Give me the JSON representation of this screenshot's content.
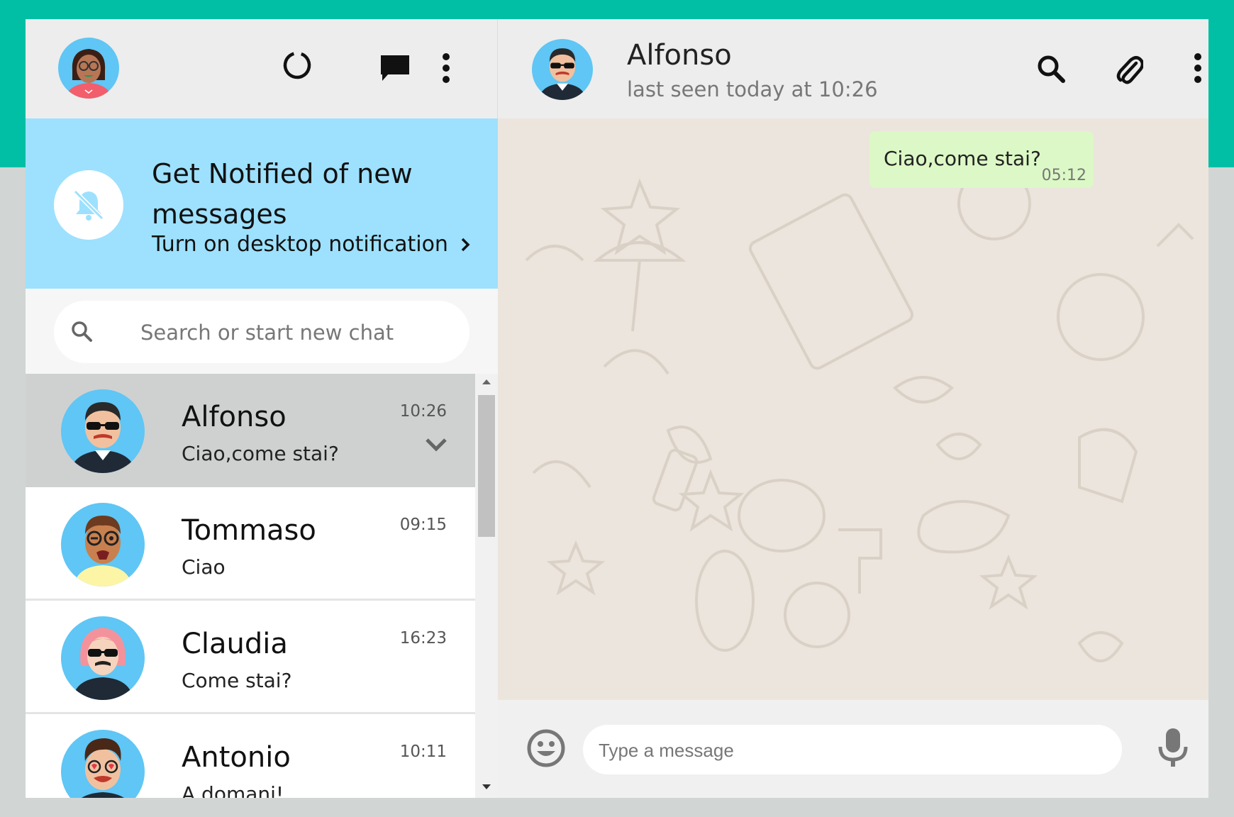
{
  "colors": {
    "brand": "#00bfa5",
    "header_bg": "#ededed",
    "notification_bg": "#9de1fe",
    "active_chat_bg": "#cfd1d1",
    "outgoing_bubble": "#dcf8c6",
    "chat_background": "#ece5dd"
  },
  "sidebar": {
    "header": {
      "icons": [
        "user-avatar",
        "status-icon",
        "new-chat-icon",
        "menu-icon"
      ]
    },
    "notification": {
      "title": "Get Notified of new messages",
      "subtitle": "Turn on desktop notification",
      "icon": "bell-off-icon"
    },
    "search": {
      "placeholder": "Search or start new chat",
      "value": ""
    },
    "chats": [
      {
        "name": "Alfonso",
        "last_message": "Ciao,come stai?",
        "time": "10:26",
        "active": true
      },
      {
        "name": "Tommaso",
        "last_message": "Ciao",
        "time": "09:15",
        "active": false
      },
      {
        "name": "Claudia",
        "last_message": "Come stai?",
        "time": "16:23",
        "active": false
      },
      {
        "name": "Antonio",
        "last_message": "A domani!",
        "time": "10:11",
        "active": false
      }
    ]
  },
  "conversation": {
    "contact_name": "Alfonso",
    "contact_status": "last seen today at 10:26",
    "header_icons": [
      "search-icon",
      "attach-icon",
      "menu-icon"
    ],
    "messages": [
      {
        "text": "Ciao,come stai?",
        "time": "05:12",
        "direction": "outgoing"
      }
    ],
    "composer": {
      "placeholder": "Type a message",
      "value": ""
    }
  }
}
